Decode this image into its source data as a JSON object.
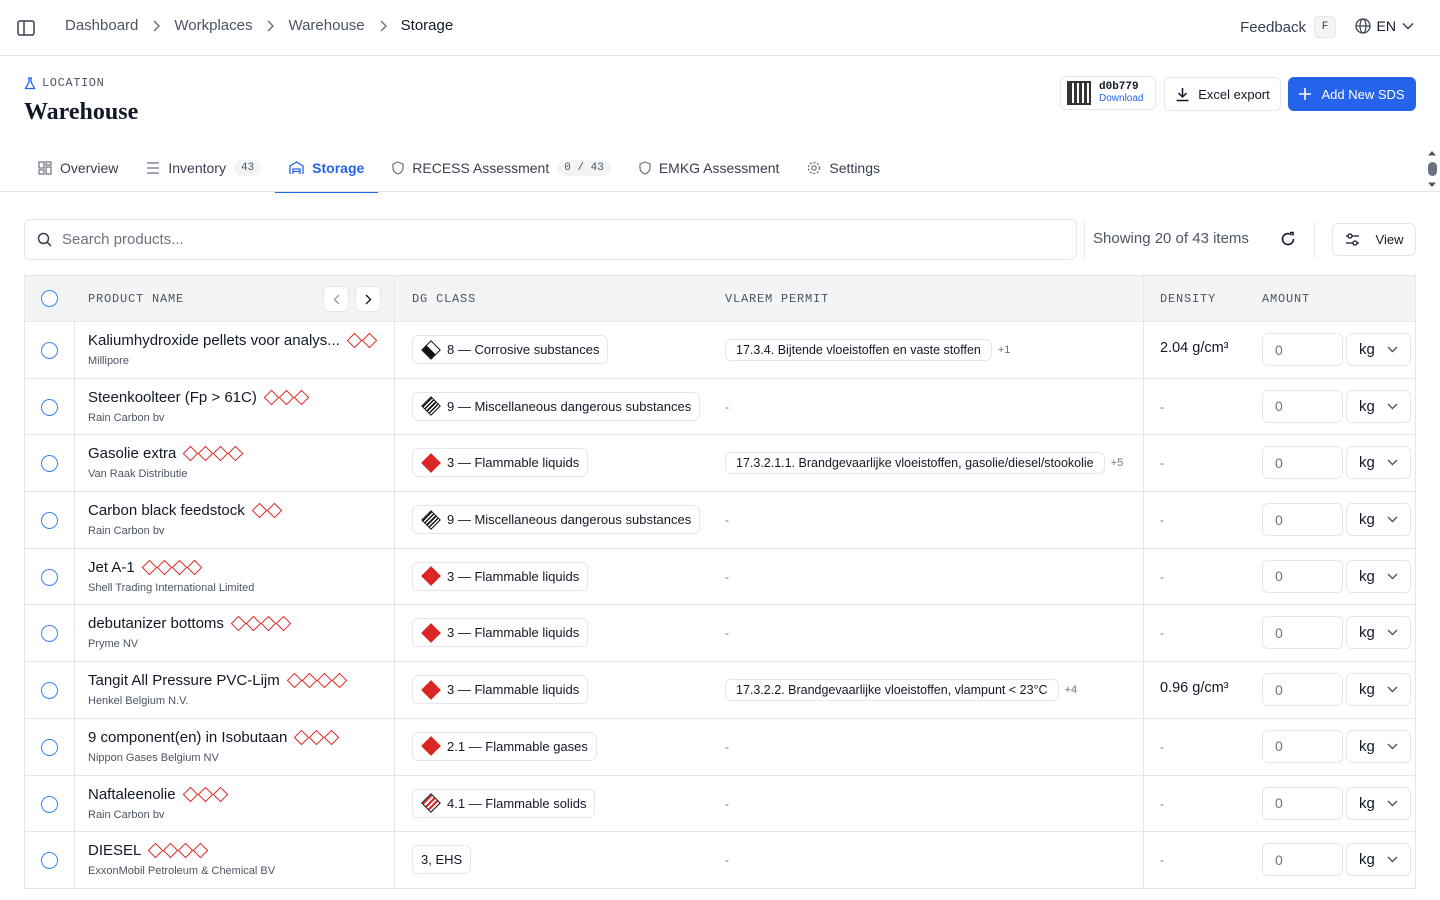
{
  "breadcrumb": [
    "Dashboard",
    "Workplaces",
    "Warehouse",
    "Storage"
  ],
  "topbar": {
    "feedback_label": "Feedback",
    "feedback_key": "F",
    "language": "EN"
  },
  "header": {
    "section_label": "LOCATION",
    "title": "Warehouse"
  },
  "actions": {
    "qr_code": "d0b779",
    "qr_download": "Download",
    "excel_export": "Excel export",
    "add_sds": "Add New SDS"
  },
  "tabs": [
    {
      "label": "Overview",
      "count": ""
    },
    {
      "label": "Inventory",
      "count": "43"
    },
    {
      "label": "Storage",
      "count": ""
    },
    {
      "label": "RECESS Assessment",
      "count": "0 / 43"
    },
    {
      "label": "EMKG Assessment",
      "count": ""
    },
    {
      "label": "Settings",
      "count": ""
    }
  ],
  "toolbar": {
    "search_placeholder": "Search products...",
    "showing": "Showing 20 of 43 items",
    "view_label": "View"
  },
  "columns": [
    "PRODUCT NAME",
    "DG CLASS",
    "VLAREM PERMIT",
    "DENSITY",
    "AMOUNT"
  ],
  "rows": [
    {
      "name": "Kaliumhydroxide pellets voor analys...",
      "maker": "Millipore",
      "hazards": 2,
      "dg": "8 — Corrosive substances",
      "dg_icon": "corrosive",
      "vlarem": "17.3.4. Bijtende vloeistoffen en vaste stoffen",
      "vlarem_more": "+1",
      "density": "2.04 g/cm³",
      "amount": "0",
      "unit": "kg"
    },
    {
      "name": "Steenkoolteer (Fp > 61C)",
      "maker": "Rain Carbon bv",
      "hazards": 3,
      "dg": "9 — Miscellaneous dangerous substances",
      "dg_icon": "misc",
      "vlarem": "-",
      "vlarem_more": "",
      "density": "-",
      "amount": "0",
      "unit": "kg"
    },
    {
      "name": "Gasolie extra",
      "maker": "Van Raak Distributie",
      "hazards": 4,
      "dg": "3 — Flammable liquids",
      "dg_icon": "flammable",
      "vlarem": "17.3.2.1.1. Brandgevaarlijke vloeistoffen, gasolie/diesel/stookolie",
      "vlarem_more": "+5",
      "density": "-",
      "amount": "0",
      "unit": "kg"
    },
    {
      "name": "Carbon black feedstock",
      "maker": "Rain Carbon bv",
      "hazards": 2,
      "dg": "9 — Miscellaneous dangerous substances",
      "dg_icon": "misc",
      "vlarem": "-",
      "vlarem_more": "",
      "density": "-",
      "amount": "0",
      "unit": "kg"
    },
    {
      "name": "Jet A-1",
      "maker": "Shell Trading International Limited",
      "hazards": 4,
      "dg": "3 — Flammable liquids",
      "dg_icon": "flammable",
      "vlarem": "-",
      "vlarem_more": "",
      "density": "-",
      "amount": "0",
      "unit": "kg"
    },
    {
      "name": "debutanizer bottoms",
      "maker": "Pryme NV",
      "hazards": 4,
      "dg": "3 — Flammable liquids",
      "dg_icon": "flammable",
      "vlarem": "-",
      "vlarem_more": "",
      "density": "-",
      "amount": "0",
      "unit": "kg"
    },
    {
      "name": "Tangit All Pressure PVC-Lijm",
      "maker": "Henkel Belgium N.V.",
      "hazards": 4,
      "dg": "3 — Flammable liquids",
      "dg_icon": "flammable",
      "vlarem": "17.3.2.2. Brandgevaarlijke vloeistoffen, vlampunt < 23°C",
      "vlarem_more": "+4",
      "density": "0.96 g/cm³",
      "amount": "0",
      "unit": "kg"
    },
    {
      "name": "9 component(en) in Isobutaan",
      "maker": "Nippon Gases Belgium NV",
      "hazards": 3,
      "dg": "2.1 — Flammable gases",
      "dg_icon": "flammable",
      "vlarem": "-",
      "vlarem_more": "",
      "density": "-",
      "amount": "0",
      "unit": "kg"
    },
    {
      "name": "Naftaleenolie",
      "maker": "Rain Carbon bv",
      "hazards": 3,
      "dg": "4.1 — Flammable solids",
      "dg_icon": "solids",
      "vlarem": "-",
      "vlarem_more": "",
      "density": "-",
      "amount": "0",
      "unit": "kg"
    },
    {
      "name": "DIESEL",
      "maker": "ExxonMobil Petroleum & Chemical BV",
      "hazards": 4,
      "dg": "3, EHS",
      "dg_icon": "none",
      "vlarem": "-",
      "vlarem_more": "",
      "density": "-",
      "amount": "0",
      "unit": "kg"
    }
  ]
}
